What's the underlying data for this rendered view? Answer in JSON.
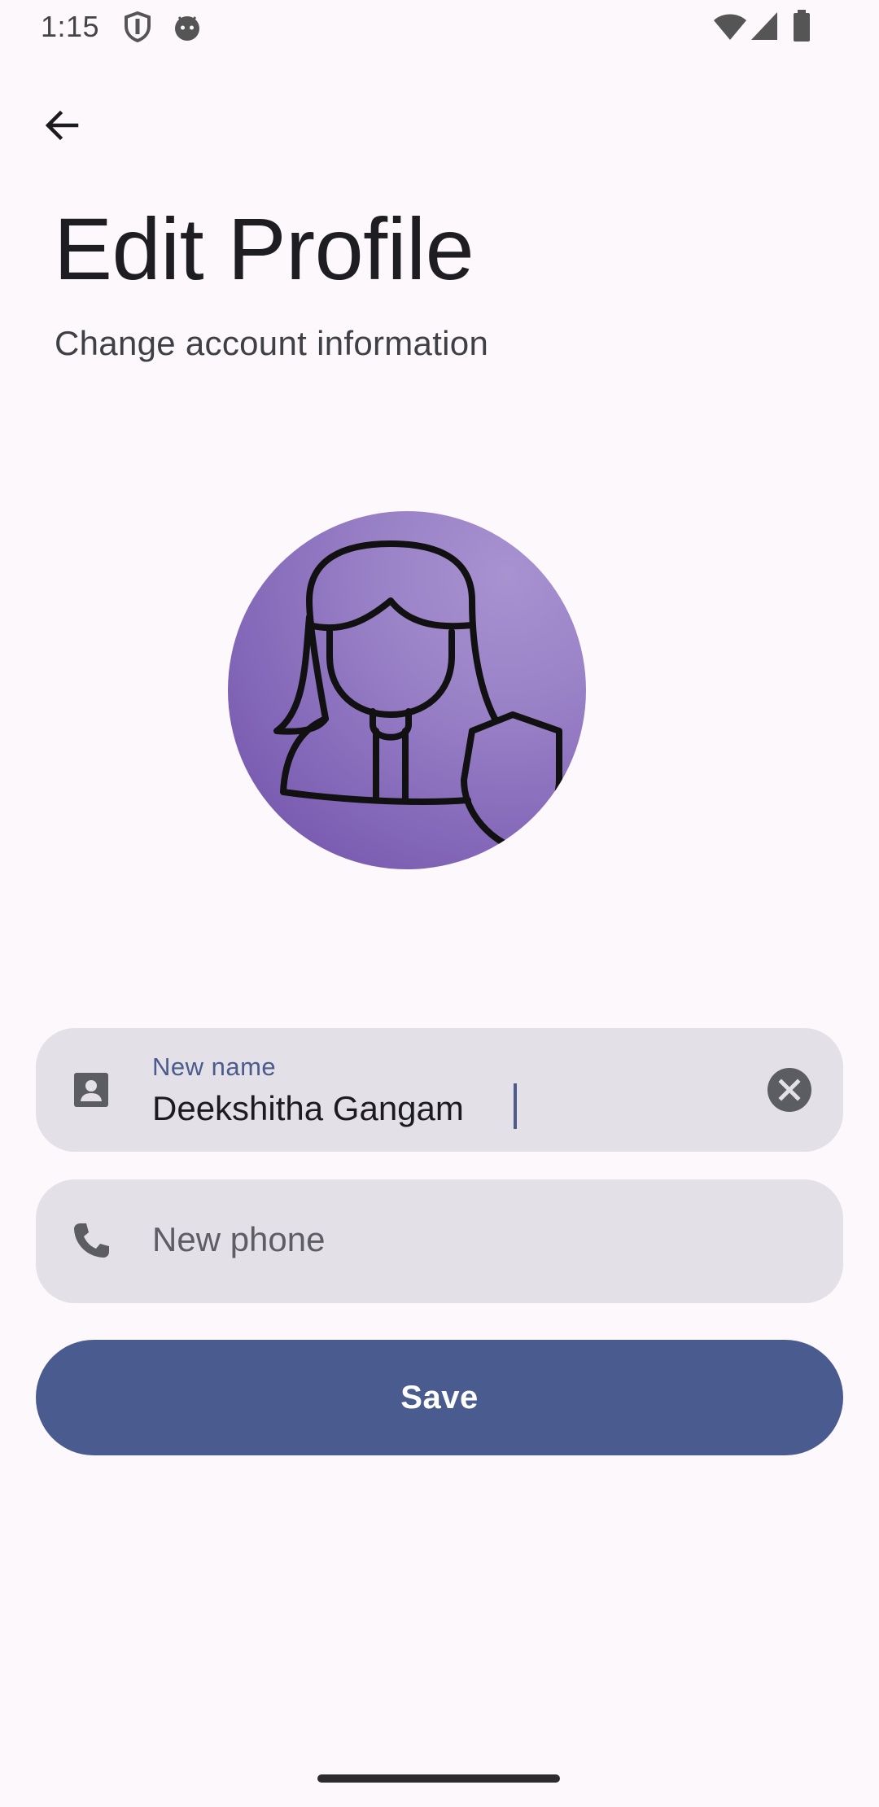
{
  "status_bar": {
    "time": "1:15",
    "left_icons": [
      "shield-icon",
      "android-face-icon"
    ],
    "right_icons": [
      "wifi-icon",
      "signal-icon",
      "battery-icon"
    ]
  },
  "header": {
    "back_icon": "arrow-back-icon",
    "title": "Edit Profile",
    "subtitle": "Change account information"
  },
  "avatar": {
    "icon": "woman-with-shield-icon",
    "colors": [
      "#a892d0",
      "#6f50a6"
    ]
  },
  "form": {
    "name_field": {
      "label": "New name",
      "value": "Deekshitha Gangam",
      "leading_icon": "contact-card-icon",
      "trailing_icon": "clear-icon"
    },
    "phone_field": {
      "placeholder": "New phone",
      "value": "",
      "leading_icon": "phone-icon"
    },
    "save_label": "Save"
  },
  "theme": {
    "background": "#fcf8fc",
    "primary": "#4a5b8f",
    "field_background": "#e3e1e7"
  }
}
